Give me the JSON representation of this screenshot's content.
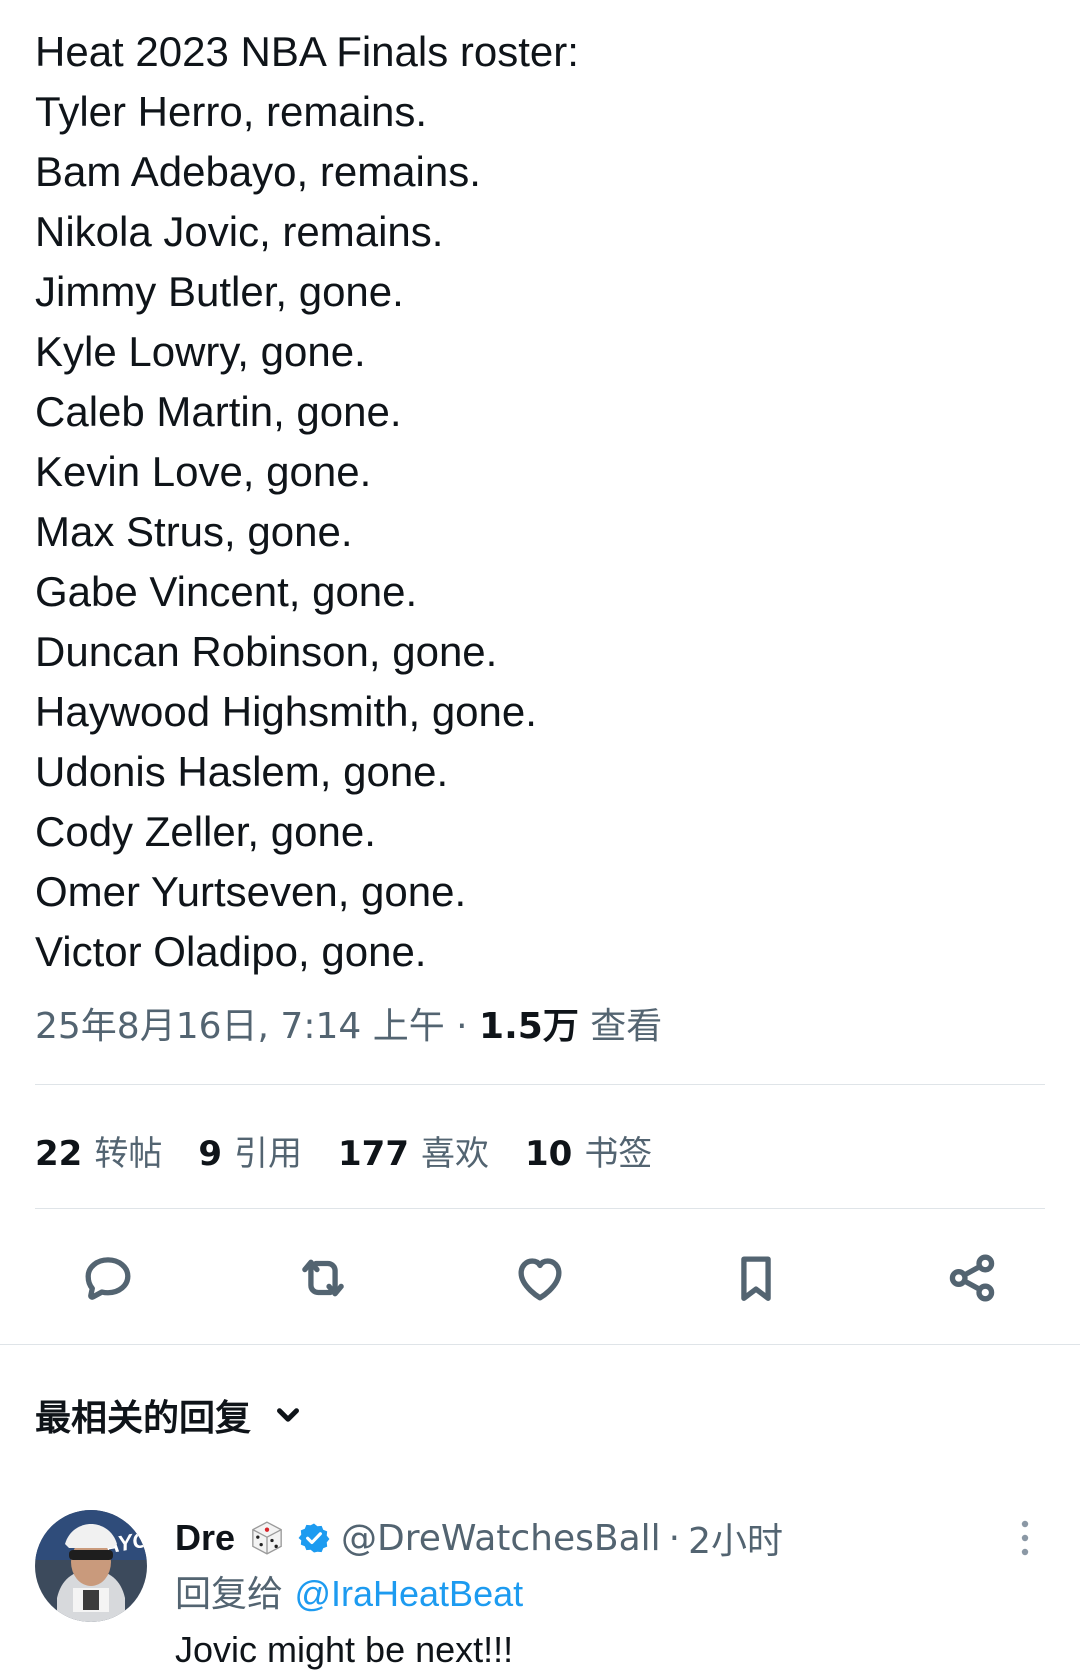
{
  "tweet": {
    "lines": [
      "Heat 2023 NBA Finals roster:",
      "Tyler Herro, remains.",
      "Bam Adebayo, remains.",
      "Nikola Jovic, remains.",
      "Jimmy Butler, gone.",
      "Kyle Lowry, gone.",
      "Caleb Martin, gone.",
      "Kevin Love, gone.",
      "Max Strus, gone.",
      "Gabe Vincent, gone.",
      "Duncan Robinson, gone.",
      "Haywood Highsmith, gone.",
      "Udonis Haslem, gone.",
      "Cody Zeller, gone.",
      "Omer Yurtseven, gone.",
      "Victor Oladipo, gone."
    ],
    "timestamp": "25年8月16日, 7:14 上午",
    "separator": " · ",
    "views_count": "1.5万",
    "views_label": "查看"
  },
  "stats": [
    {
      "count": "22",
      "label": "转帖"
    },
    {
      "count": "9",
      "label": "引用"
    },
    {
      "count": "177",
      "label": "喜欢"
    },
    {
      "count": "10",
      "label": "书签"
    }
  ],
  "actions": [
    "reply-icon",
    "retweet-icon",
    "like-icon",
    "bookmark-icon",
    "share-icon"
  ],
  "replies_section": {
    "title": "最相关的回复",
    "icon": "chevron-down-icon"
  },
  "reply": {
    "name": "Dre",
    "emoji_icon": "dice-icon",
    "verified_icon": "verified-badge-icon",
    "handle": "@DreWatchesBall",
    "dot": "·",
    "time": "2小时",
    "reply_to_label": "回复给 ",
    "reply_to_handle": "@IraHeatBeat",
    "text": "Jovic might be next!!!"
  },
  "colors": {
    "text": "#0f1419",
    "secondary": "#536471",
    "link": "#1d9bf0",
    "divider": "#dfe4e8"
  }
}
